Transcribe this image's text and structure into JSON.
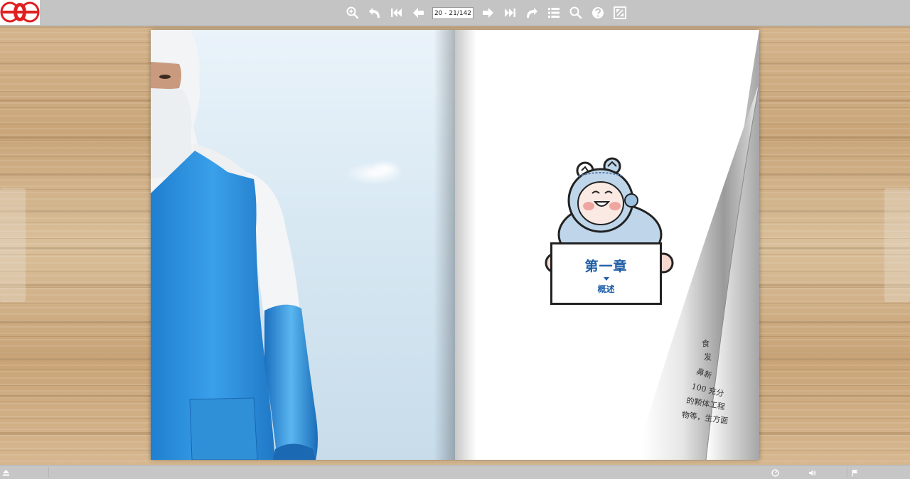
{
  "toolbar": {
    "page_indicator": "20 - 21/142",
    "tools": [
      "zoom-in-icon",
      "undo-icon",
      "first-page-icon",
      "prev-page-icon",
      "next-page-icon",
      "last-page-icon",
      "redo-icon",
      "table-of-contents-icon",
      "search-icon",
      "help-icon",
      "fullscreen-icon"
    ]
  },
  "chapter": {
    "title": "第一章",
    "subtitle": "概述"
  },
  "page_curl_text": [
    "食",
    "发",
    "鼻新",
    "100 充分",
    "的颗体工程",
    "物等，生方面"
  ],
  "colors": {
    "toolbar_bg": "#c4c4c4",
    "chapter_blue": "#1e5da6",
    "apron_blue": "#2a8ed8",
    "logo_red": "#e02020"
  }
}
